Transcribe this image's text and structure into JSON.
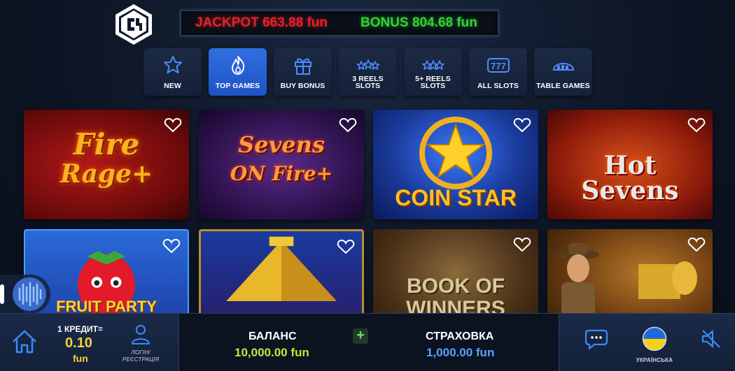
{
  "header": {
    "jackpot_label": "JACKPOT 663.88 fun",
    "bonus_label": "BONUS 804.68 fun"
  },
  "categories": [
    {
      "label": "NEW",
      "icon": "star-icon",
      "active": false
    },
    {
      "label": "TOP GAMES",
      "icon": "flame-icon",
      "active": true
    },
    {
      "label": "BUY BONUS",
      "icon": "gift-icon",
      "active": false
    },
    {
      "label": "3 REELS SLOTS",
      "label_l1": "3 REELS",
      "label_l2": "SLOTS",
      "icon": "three-stars-icon",
      "active": false
    },
    {
      "label": "5+ REELS SLOTS",
      "label_l1": "5+ REELS",
      "label_l2": "SLOTS",
      "icon": "stars-icon",
      "active": false
    },
    {
      "label": "ALL SLOTS",
      "icon": "slot-777-icon",
      "active": false
    },
    {
      "label": "TABLE GAMES",
      "icon": "table-games-icon",
      "active": false
    }
  ],
  "games": [
    {
      "line1": "Fire",
      "line2": "Rage+"
    },
    {
      "line1": "Sevens",
      "line2": "ON Fire+"
    },
    {
      "line1": "COIN STAR",
      "line2": ""
    },
    {
      "line1": "Hot",
      "line2": "Sevens"
    },
    {
      "line1": "FRUIT PARTY",
      "line2": ""
    },
    {
      "line1": "",
      "line2": ""
    },
    {
      "line1": "BOOK OF",
      "line2": "WINNERS"
    },
    {
      "line1": "",
      "line2": ""
    }
  ],
  "bottom": {
    "credit_label": "1 КРЕДИТ=",
    "credit_value": "0.10",
    "credit_unit": "fun",
    "login_label_1": "ЛОГІН/",
    "login_label_2": "РЕЄСТРАЦІЯ",
    "balance_label": "БАЛАНС",
    "balance_value": "10,000.00 fun",
    "insurance_label": "СТРАХОВКА",
    "insurance_value": "1,000.00 fun",
    "plus_label": "+",
    "language_label": "УКРАЇНСЬКА"
  },
  "colors": {
    "jackpot": "#e8202a",
    "bonus": "#2fd42f",
    "active_tab": "#2f6fe0",
    "balance": "#c9e33a",
    "insurance": "#5aa3ff"
  }
}
